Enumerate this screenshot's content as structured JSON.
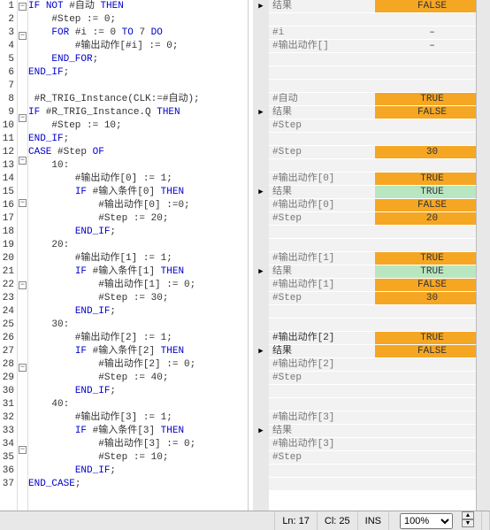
{
  "lines": [
    {
      "n": "1",
      "fold": "⊟",
      "code": [
        [
          "kw",
          "IF"
        ],
        [
          "op",
          " "
        ],
        [
          "kw",
          "NOT"
        ],
        [
          "var",
          " #自动 "
        ],
        [
          "kw",
          "THEN"
        ]
      ],
      "mark": "▶",
      "ml": "结果",
      "mv": "FALSE",
      "mvcls": "v-orange"
    },
    {
      "n": "2",
      "fold": "",
      "code": [
        [
          "op",
          "    #Step := "
        ],
        [
          "num",
          "0"
        ],
        [
          "op",
          ";"
        ]
      ],
      "mark": "",
      "ml": "",
      "mv": ""
    },
    {
      "n": "3",
      "fold": "⊟",
      "code": [
        [
          "op",
          "    "
        ],
        [
          "kw",
          "FOR"
        ],
        [
          "var",
          " #i := "
        ],
        [
          "num",
          "0"
        ],
        [
          "kw",
          " TO "
        ],
        [
          "num",
          "7"
        ],
        [
          "kw",
          " DO"
        ]
      ],
      "mark": "",
      "ml": "#i",
      "mv": "–",
      "mvcls": "v-dash"
    },
    {
      "n": "4",
      "fold": "",
      "code": [
        [
          "op",
          "        #输出动作[#i] := "
        ],
        [
          "num",
          "0"
        ],
        [
          "op",
          ";"
        ]
      ],
      "mark": "",
      "ml": "#输出动作[]",
      "mv": "–",
      "mvcls": "v-dash"
    },
    {
      "n": "5",
      "fold": "",
      "code": [
        [
          "op",
          "    "
        ],
        [
          "kw",
          "END_FOR"
        ],
        [
          "op",
          ";"
        ]
      ],
      "mark": "",
      "ml": "",
      "mv": ""
    },
    {
      "n": "6",
      "fold": "",
      "code": [
        [
          "kw",
          "END_IF"
        ],
        [
          "op",
          ";"
        ]
      ],
      "mark": "",
      "ml": "",
      "mv": ""
    },
    {
      "n": "7",
      "fold": "",
      "code": [
        [
          "op",
          " "
        ]
      ],
      "mark": "",
      "ml": "",
      "mv": ""
    },
    {
      "n": "8",
      "fold": "",
      "code": [
        [
          "op",
          " "
        ],
        [
          "var",
          "#R_TRIG_Instance"
        ],
        [
          "op",
          "("
        ],
        [
          "var",
          "CLK:=#自动"
        ],
        [
          "op",
          ");"
        ]
      ],
      "mark": "",
      "ml": "#自动",
      "mv": "TRUE",
      "mvcls": "v-orange"
    },
    {
      "n": "9",
      "fold": "⊟",
      "code": [
        [
          "kw",
          "IF"
        ],
        [
          "var",
          " #R_TRIG_Instance.Q "
        ],
        [
          "kw",
          "THEN"
        ]
      ],
      "mark": "▶",
      "ml": "结果",
      "mv": "FALSE",
      "mvcls": "v-orange"
    },
    {
      "n": "10",
      "fold": "",
      "code": [
        [
          "op",
          "    #Step := "
        ],
        [
          "num",
          "10"
        ],
        [
          "op",
          ";"
        ]
      ],
      "mark": "",
      "ml": "#Step",
      "mv": ""
    },
    {
      "n": "11",
      "fold": "",
      "code": [
        [
          "kw",
          "END_IF"
        ],
        [
          "op",
          ";"
        ]
      ],
      "mark": "",
      "ml": "",
      "mv": ""
    },
    {
      "n": "12",
      "fold": "⊟",
      "code": [
        [
          "kw",
          "CASE"
        ],
        [
          "var",
          " #Step "
        ],
        [
          "kw",
          "OF"
        ]
      ],
      "mark": "",
      "ml": "#Step",
      "mv": "30",
      "mvcls": "v-orange"
    },
    {
      "n": "13",
      "fold": "",
      "code": [
        [
          "op",
          "    "
        ],
        [
          "num",
          "10"
        ],
        [
          "op",
          ":"
        ]
      ],
      "mark": "",
      "ml": "",
      "mv": ""
    },
    {
      "n": "14",
      "fold": "",
      "code": [
        [
          "op",
          "        #输出动作["
        ],
        [
          "num",
          "0"
        ],
        [
          "op",
          "] := "
        ],
        [
          "num",
          "1"
        ],
        [
          "op",
          ";"
        ]
      ],
      "mark": "",
      "ml": "#输出动作[0]",
      "mv": "TRUE",
      "mvcls": "v-orange"
    },
    {
      "n": "15",
      "fold": "⊟",
      "code": [
        [
          "op",
          "        "
        ],
        [
          "kw",
          "IF"
        ],
        [
          "var",
          " #输入条件["
        ],
        [
          "num",
          "0"
        ],
        [
          "var",
          "] "
        ],
        [
          "kw",
          "THEN"
        ]
      ],
      "mark": "▶",
      "ml": "结果",
      "mv": "TRUE",
      "mvcls": "v-green"
    },
    {
      "n": "16",
      "fold": "",
      "code": [
        [
          "op",
          "            #输出动作["
        ],
        [
          "num",
          "0"
        ],
        [
          "op",
          "] :="
        ],
        [
          "num",
          "0"
        ],
        [
          "op",
          ";"
        ]
      ],
      "mark": "",
      "ml": "#输出动作[0]",
      "mv": "FALSE",
      "mvcls": "v-orange"
    },
    {
      "n": "17",
      "fold": "",
      "code": [
        [
          "op",
          "            #Step := "
        ],
        [
          "num",
          "20"
        ],
        [
          "op",
          ";"
        ]
      ],
      "mark": "",
      "ml": "#Step",
      "mv": "20",
      "mvcls": "v-orange"
    },
    {
      "n": "18",
      "fold": "",
      "code": [
        [
          "op",
          "        "
        ],
        [
          "kw",
          "END_IF"
        ],
        [
          "op",
          ";"
        ]
      ],
      "mark": "",
      "ml": "",
      "mv": ""
    },
    {
      "n": "19",
      "fold": "",
      "code": [
        [
          "op",
          "    "
        ],
        [
          "num",
          "20"
        ],
        [
          "op",
          ":"
        ]
      ],
      "mark": "",
      "ml": "",
      "mv": ""
    },
    {
      "n": "20",
      "fold": "",
      "code": [
        [
          "op",
          "        #输出动作["
        ],
        [
          "num",
          "1"
        ],
        [
          "op",
          "] := "
        ],
        [
          "num",
          "1"
        ],
        [
          "op",
          ";"
        ]
      ],
      "mark": "",
      "ml": "#输出动作[1]",
      "mv": "TRUE",
      "mvcls": "v-orange"
    },
    {
      "n": "21",
      "fold": "⊟",
      "code": [
        [
          "op",
          "        "
        ],
        [
          "kw",
          "IF"
        ],
        [
          "var",
          " #输入条件["
        ],
        [
          "num",
          "1"
        ],
        [
          "var",
          "] "
        ],
        [
          "kw",
          "THEN"
        ]
      ],
      "mark": "▶",
      "ml": "结果",
      "mv": "TRUE",
      "mvcls": "v-green"
    },
    {
      "n": "22",
      "fold": "",
      "code": [
        [
          "op",
          "            #输出动作["
        ],
        [
          "num",
          "1"
        ],
        [
          "op",
          "] := "
        ],
        [
          "num",
          "0"
        ],
        [
          "op",
          ";"
        ]
      ],
      "mark": "",
      "ml": "#输出动作[1]",
      "mv": "FALSE",
      "mvcls": "v-orange"
    },
    {
      "n": "23",
      "fold": "",
      "code": [
        [
          "op",
          "            #Step := "
        ],
        [
          "num",
          "30"
        ],
        [
          "op",
          ";"
        ]
      ],
      "mark": "",
      "ml": "#Step",
      "mv": "30",
      "mvcls": "v-orange"
    },
    {
      "n": "24",
      "fold": "",
      "code": [
        [
          "op",
          "        "
        ],
        [
          "kw",
          "END_IF"
        ],
        [
          "op",
          ";"
        ]
      ],
      "mark": "",
      "ml": "",
      "mv": ""
    },
    {
      "n": "25",
      "fold": "",
      "code": [
        [
          "op",
          "    "
        ],
        [
          "num",
          "30"
        ],
        [
          "op",
          ":"
        ]
      ],
      "mark": "",
      "ml": "",
      "mv": ""
    },
    {
      "n": "26",
      "fold": "",
      "code": [
        [
          "op",
          "        #输出动作["
        ],
        [
          "num",
          "2"
        ],
        [
          "op",
          "] := "
        ],
        [
          "num",
          "1"
        ],
        [
          "op",
          ";"
        ]
      ],
      "mark": "",
      "ml": "#输出动作[2]",
      "mlact": 1,
      "mv": "TRUE",
      "mvcls": "v-orange"
    },
    {
      "n": "27",
      "fold": "⊟",
      "code": [
        [
          "op",
          "        "
        ],
        [
          "kw",
          "IF"
        ],
        [
          "var",
          " #输入条件["
        ],
        [
          "num",
          "2"
        ],
        [
          "var",
          "] "
        ],
        [
          "kw",
          "THEN"
        ]
      ],
      "mark": "▶",
      "ml": "结果",
      "mlact": 1,
      "mv": "FALSE",
      "mvcls": "v-orange"
    },
    {
      "n": "28",
      "fold": "",
      "code": [
        [
          "op",
          "            #输出动作["
        ],
        [
          "num",
          "2"
        ],
        [
          "op",
          "] := "
        ],
        [
          "num",
          "0"
        ],
        [
          "op",
          ";"
        ]
      ],
      "mark": "",
      "ml": "#输出动作[2]",
      "mv": ""
    },
    {
      "n": "29",
      "fold": "",
      "code": [
        [
          "op",
          "            #Step := "
        ],
        [
          "num",
          "40"
        ],
        [
          "op",
          ";"
        ]
      ],
      "mark": "",
      "ml": "#Step",
      "mv": ""
    },
    {
      "n": "30",
      "fold": "",
      "code": [
        [
          "op",
          "        "
        ],
        [
          "kw",
          "END_IF"
        ],
        [
          "op",
          ";"
        ]
      ],
      "mark": "",
      "ml": "",
      "mv": ""
    },
    {
      "n": "31",
      "fold": "",
      "code": [
        [
          "op",
          "    "
        ],
        [
          "num",
          "40"
        ],
        [
          "op",
          ":"
        ]
      ],
      "mark": "",
      "ml": "",
      "mv": ""
    },
    {
      "n": "32",
      "fold": "",
      "code": [
        [
          "op",
          "        #输出动作["
        ],
        [
          "num",
          "3"
        ],
        [
          "op",
          "] := "
        ],
        [
          "num",
          "1"
        ],
        [
          "op",
          ";"
        ]
      ],
      "mark": "",
      "ml": "#输出动作[3]",
      "mv": ""
    },
    {
      "n": "33",
      "fold": "⊟",
      "code": [
        [
          "op",
          "        "
        ],
        [
          "kw",
          "IF"
        ],
        [
          "var",
          " #输入条件["
        ],
        [
          "num",
          "3"
        ],
        [
          "var",
          "] "
        ],
        [
          "kw",
          "THEN"
        ]
      ],
      "mark": "▶",
      "ml": "结果",
      "mv": ""
    },
    {
      "n": "34",
      "fold": "",
      "code": [
        [
          "op",
          "            #输出动作["
        ],
        [
          "num",
          "3"
        ],
        [
          "op",
          "] := "
        ],
        [
          "num",
          "0"
        ],
        [
          "op",
          ";"
        ]
      ],
      "mark": "",
      "ml": "#输出动作[3]",
      "mv": ""
    },
    {
      "n": "35",
      "fold": "",
      "code": [
        [
          "op",
          "            #Step := "
        ],
        [
          "num",
          "10"
        ],
        [
          "op",
          ";"
        ]
      ],
      "mark": "",
      "ml": "#Step",
      "mv": ""
    },
    {
      "n": "36",
      "fold": "",
      "code": [
        [
          "op",
          "        "
        ],
        [
          "kw",
          "END_IF"
        ],
        [
          "op",
          ";"
        ]
      ],
      "mark": "",
      "ml": "",
      "mv": ""
    },
    {
      "n": "37",
      "fold": "",
      "code": [
        [
          "kw",
          "END_CASE"
        ],
        [
          "op",
          ";"
        ]
      ],
      "mark": "",
      "ml": "",
      "mv": ""
    }
  ],
  "status": {
    "ln": "Ln: 17",
    "cl": "Cl: 25",
    "ins": "INS",
    "zoom": "100%"
  }
}
